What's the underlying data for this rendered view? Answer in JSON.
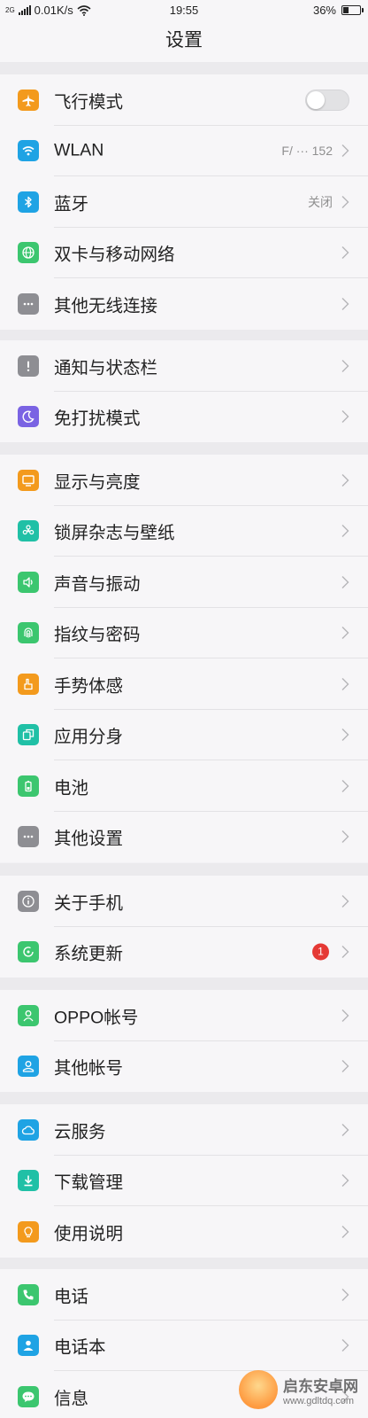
{
  "status_bar": {
    "sim_label": "2G",
    "speed": "0.01K/s",
    "time": "19:55",
    "battery_percent": "36%",
    "battery_level": 0.36
  },
  "title": "设置",
  "groups": [
    {
      "items": [
        {
          "label": "飞行模式",
          "icon": "airplane-icon",
          "color": "#f39a1d",
          "toggle": true,
          "toggle_on": false
        },
        {
          "label": "WLAN",
          "icon": "wifi-icon",
          "color": "#1fa3e4",
          "value": "F/ ··· 152"
        },
        {
          "label": "蓝牙",
          "icon": "bluetooth-icon",
          "color": "#1fa3e4",
          "value": "关闭"
        },
        {
          "label": "双卡与移动网络",
          "icon": "globe-icon",
          "color": "#3cc66f"
        },
        {
          "label": "其他无线连接",
          "icon": "more-icon",
          "color": "#8e8e93"
        }
      ]
    },
    {
      "items": [
        {
          "label": "通知与状态栏",
          "icon": "exclamation-icon",
          "color": "#8e8e93"
        },
        {
          "label": "免打扰模式",
          "icon": "moon-icon",
          "color": "#7a63e3"
        }
      ]
    },
    {
      "items": [
        {
          "label": "显示与亮度",
          "icon": "display-icon",
          "color": "#f39a1d"
        },
        {
          "label": "锁屏杂志与壁纸",
          "icon": "flower-icon",
          "color": "#20c0a6"
        },
        {
          "label": "声音与振动",
          "icon": "speaker-icon",
          "color": "#3cc66f"
        },
        {
          "label": "指纹与密码",
          "icon": "fingerprint-icon",
          "color": "#3cc66f"
        },
        {
          "label": "手势体感",
          "icon": "hand-icon",
          "color": "#f39a1d"
        },
        {
          "label": "应用分身",
          "icon": "clone-icon",
          "color": "#20c0a6"
        },
        {
          "label": "电池",
          "icon": "battery-icon",
          "color": "#3cc66f"
        },
        {
          "label": "其他设置",
          "icon": "more-icon",
          "color": "#8e8e93"
        }
      ]
    },
    {
      "items": [
        {
          "label": "关于手机",
          "icon": "info-icon",
          "color": "#8e8e93"
        },
        {
          "label": "系统更新",
          "icon": "update-icon",
          "color": "#3cc66f",
          "badge": "1"
        }
      ]
    },
    {
      "items": [
        {
          "label": "OPPO帐号",
          "icon": "account-icon",
          "color": "#3cc66f"
        },
        {
          "label": "其他帐号",
          "icon": "user-icon",
          "color": "#1fa3e4"
        }
      ]
    },
    {
      "items": [
        {
          "label": "云服务",
          "icon": "cloud-icon",
          "color": "#1fa3e4"
        },
        {
          "label": "下载管理",
          "icon": "download-icon",
          "color": "#20c0a6"
        },
        {
          "label": "使用说明",
          "icon": "lightbulb-icon",
          "color": "#f39a1d"
        }
      ]
    },
    {
      "items": [
        {
          "label": "电话",
          "icon": "phone-icon",
          "color": "#3cc66f"
        },
        {
          "label": "电话本",
          "icon": "contacts-icon",
          "color": "#1fa3e4"
        },
        {
          "label": "信息",
          "icon": "message-icon",
          "color": "#3cc66f"
        }
      ]
    }
  ],
  "watermark": {
    "line1": "启东安卓网",
    "line2": "www.gdltdq.com"
  }
}
